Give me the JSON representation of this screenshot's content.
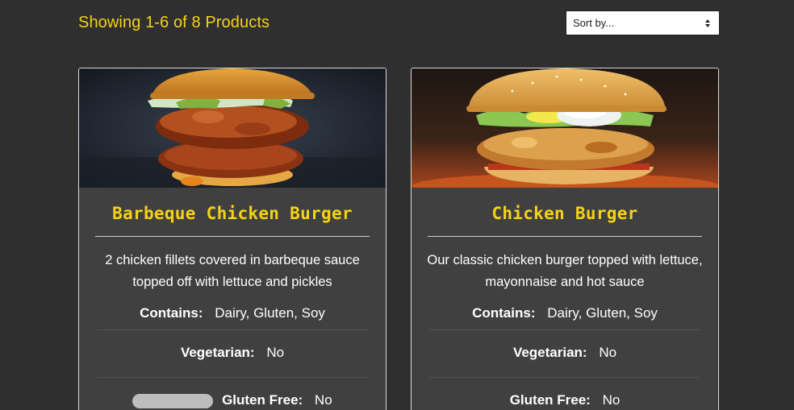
{
  "header": {
    "results_count": "Showing 1-6 of 8 Products",
    "sort": {
      "selected": "Sort by..."
    }
  },
  "products": [
    {
      "title": "Barbeque Chicken Burger",
      "description": "2 chicken fillets covered in barbeque sauce topped off with lettuce and pickles",
      "contains_label": "Contains:",
      "contains_value": "Dairy, Gluten, Soy",
      "vegetarian_label": "Vegetarian:",
      "vegetarian_value": "No",
      "gluten_free_label": "Gluten Free:",
      "gluten_free_value": "No"
    },
    {
      "title": "Chicken Burger",
      "description": "Our classic chicken burger topped with lettuce, mayonnaise and hot sauce",
      "contains_label": "Contains:",
      "contains_value": "Dairy, Gluten, Soy",
      "vegetarian_label": "Vegetarian:",
      "vegetarian_value": "No",
      "gluten_free_label": "Gluten Free:",
      "gluten_free_value": "No"
    }
  ],
  "colors": {
    "accent": "#f4d316",
    "background": "#2f2f2f",
    "card": "#404040"
  }
}
